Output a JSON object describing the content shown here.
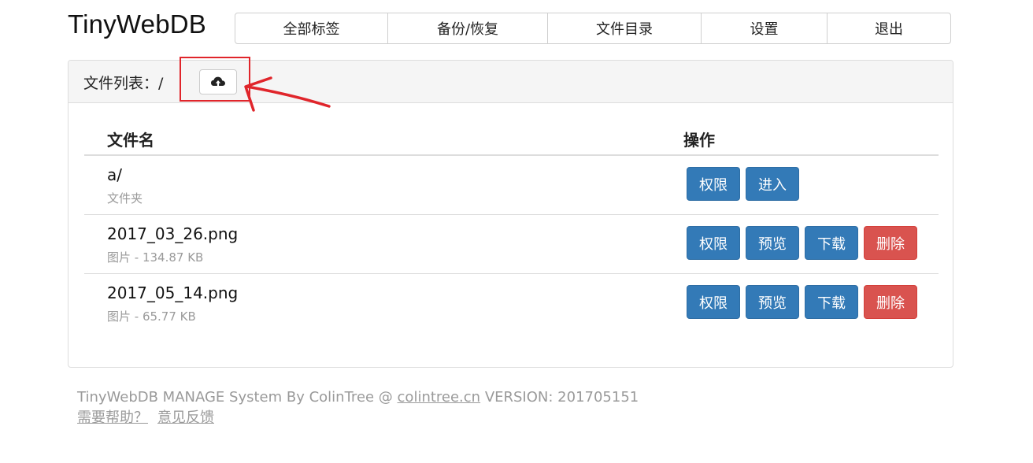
{
  "brand": "TinyWebDB",
  "nav": [
    "全部标签",
    "备份/恢复",
    "文件目录",
    "设置",
    "退出"
  ],
  "panel": {
    "title": "文件列表：/",
    "upload_icon": "cloud-upload-icon"
  },
  "table": {
    "headers": {
      "name": "文件名",
      "ops": "操作"
    },
    "rows": [
      {
        "name": "a/",
        "meta": "文件夹",
        "actions": [
          "权限",
          "进入"
        ]
      },
      {
        "name": "2017_03_26.png",
        "meta": "图片 - 134.87 KB",
        "actions": [
          "权限",
          "预览",
          "下载",
          "删除"
        ]
      },
      {
        "name": "2017_05_14.png",
        "meta": "图片 - 65.77 KB",
        "actions": [
          "权限",
          "预览",
          "下载",
          "删除"
        ]
      }
    ]
  },
  "footer": {
    "prefix": "TinyWebDB MANAGE System By ColinTree @ ",
    "link": "colintree.cn",
    "suffix": " VERSION: 201705151",
    "help": "需要帮助？",
    "feedback": "意见反馈"
  },
  "colors": {
    "primary": "#337ab7",
    "danger": "#d9534f",
    "annotation": "#e0252b"
  }
}
